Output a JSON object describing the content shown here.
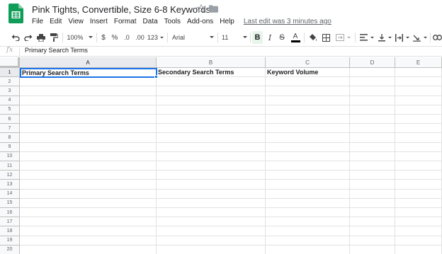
{
  "app": {
    "doc_title": "Pink Tights, Convertible, Size 6-8 Keywords",
    "last_edit": "Last edit was 3 minutes ago",
    "brand_color": "#0f9d58",
    "accent_color": "#1a73e8"
  },
  "menu": [
    "File",
    "Edit",
    "View",
    "Insert",
    "Format",
    "Data",
    "Tools",
    "Add-ons",
    "Help"
  ],
  "toolbar": {
    "zoom": "100%",
    "currency": "$",
    "percent": "%",
    "decrease_decimals": ".0",
    "increase_decimals": ".00",
    "more_formats": "123",
    "font": "Arial",
    "font_size": "11",
    "italic": "I",
    "bold": "B",
    "strikethrough": "S",
    "text_color": "A"
  },
  "formula_bar": {
    "fx": "fx",
    "value": "Primary Search Terms"
  },
  "sheet": {
    "columns": [
      "A",
      "B",
      "C",
      "D",
      "E"
    ],
    "rows": [
      "1",
      "2",
      "3",
      "4",
      "5",
      "6",
      "7",
      "8",
      "9",
      "10",
      "11",
      "12",
      "13",
      "14",
      "15",
      "16",
      "17",
      "18",
      "19",
      "20"
    ],
    "row1": [
      "Primary Search Terms",
      "Secondary Search Terms",
      "Keyword Volume",
      "",
      ""
    ],
    "active_cell": "A1"
  }
}
